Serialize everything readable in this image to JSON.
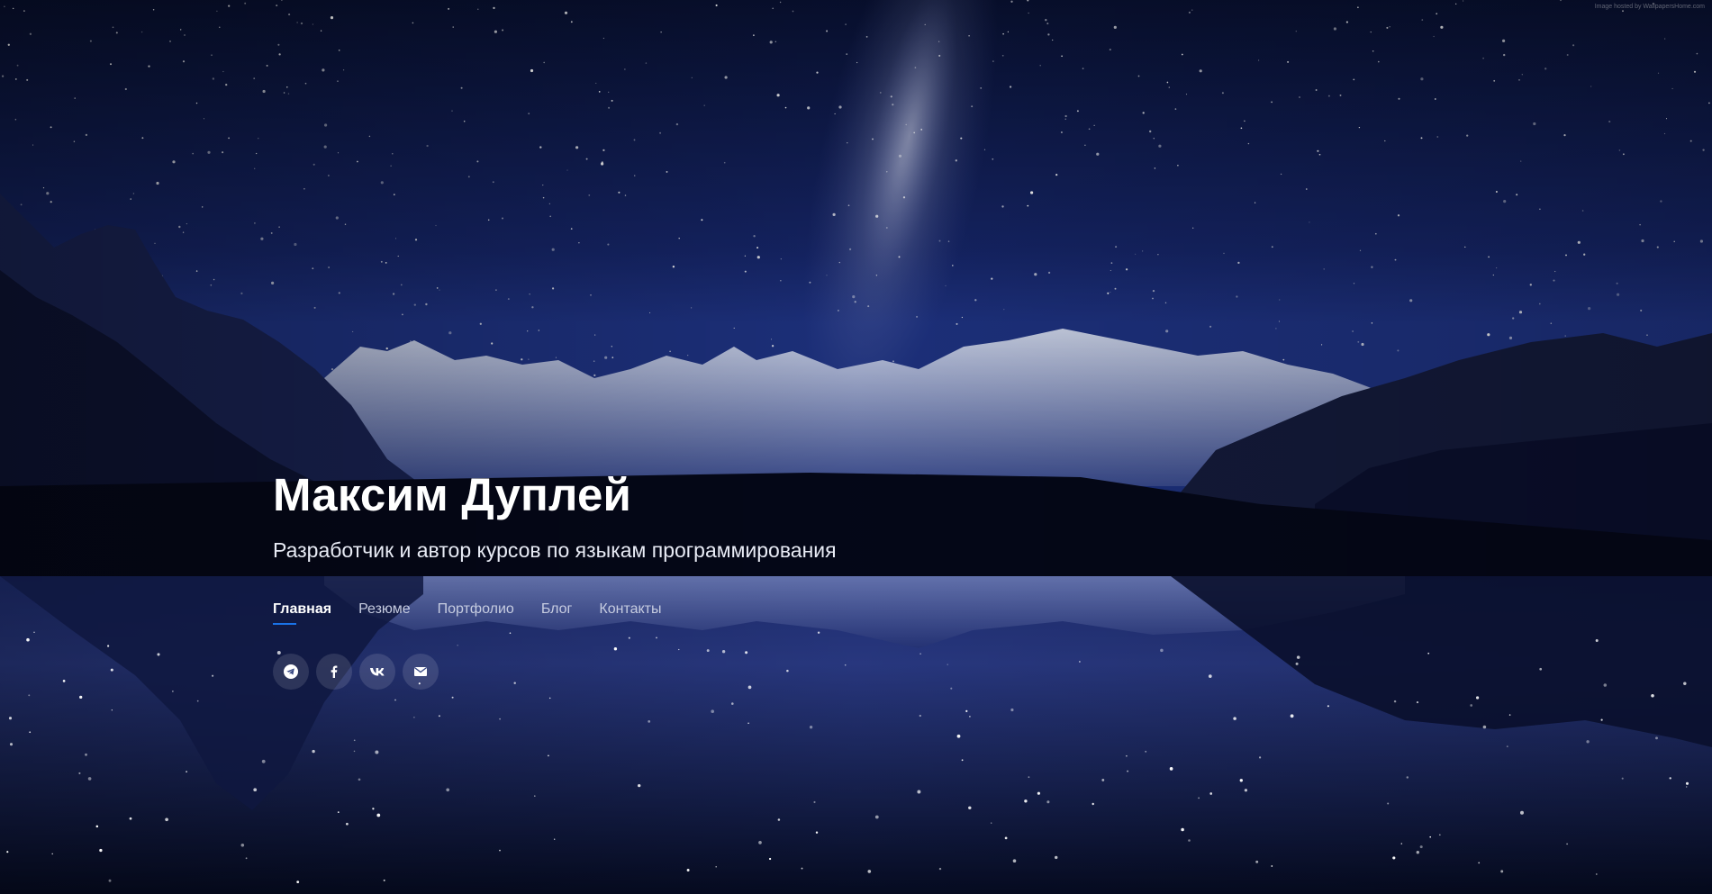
{
  "hero": {
    "name": "Максим Дуплей",
    "subtitle": "Разработчик и автор курсов по языкам программирования",
    "credit": "Image hosted by WallpapersHome.com"
  },
  "nav": {
    "items": [
      {
        "label": "Главная",
        "active": true
      },
      {
        "label": "Резюме",
        "active": false
      },
      {
        "label": "Портфолио",
        "active": false
      },
      {
        "label": "Блог",
        "active": false
      },
      {
        "label": "Контакты",
        "active": false
      }
    ]
  },
  "social": [
    {
      "icon": "telegram-icon"
    },
    {
      "icon": "facebook-icon"
    },
    {
      "icon": "vk-icon"
    },
    {
      "icon": "envelope-icon"
    }
  ],
  "colors": {
    "accent": "#1a73e8",
    "sky_top": "#0a1336",
    "sky_bottom": "#1c2c6e",
    "water": "#0b1434"
  }
}
